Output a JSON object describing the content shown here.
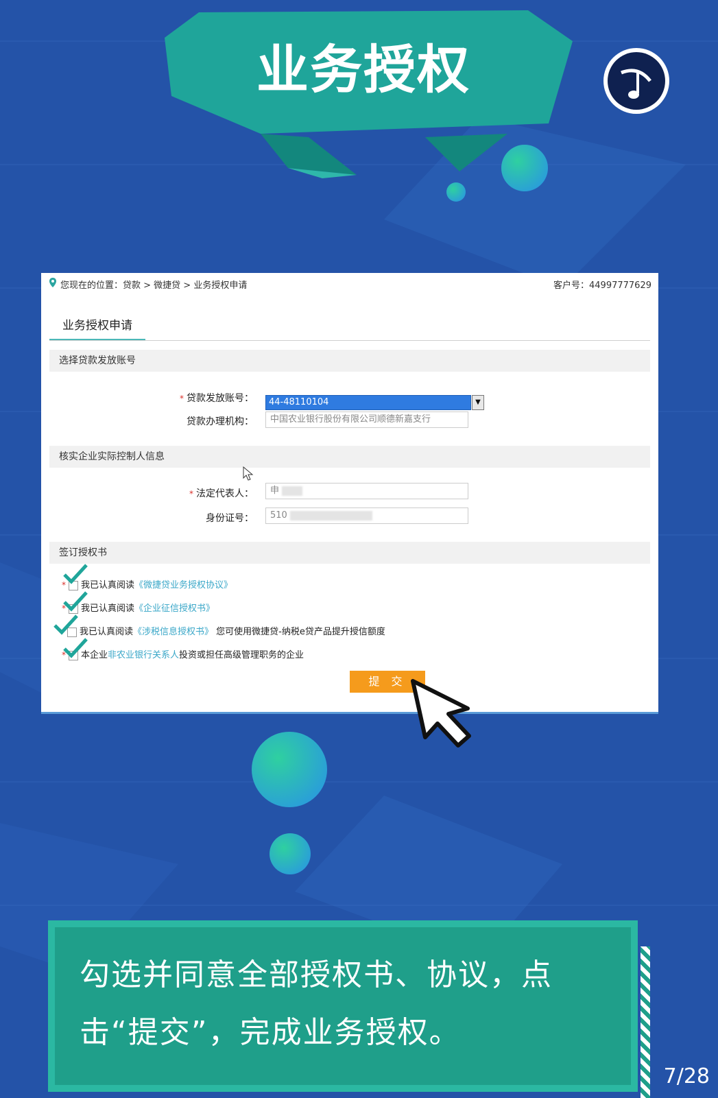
{
  "banner": {
    "title": "业务授权"
  },
  "logo": {
    "icon": "music-note-icon"
  },
  "screen": {
    "breadcrumb": "您现在的位置：贷款 > 微捷贷 > 业务授权申请",
    "customer_id": "客户号：44997777629",
    "tab": "业务授权申请",
    "section_account": "选择贷款发放账号",
    "label_account": "贷款发放账号：",
    "account_value": "44-48110104",
    "label_org": "贷款办理机构：",
    "org_placeholder": "中国农业银行股份有限公司顺德新嘉支行",
    "section_controller": "核实企业实际控制人信息",
    "label_legal_rep": "法定代表人：",
    "legal_rep_value": "申",
    "label_id": "身份证号：",
    "id_value": "510",
    "section_sign": "签订授权书",
    "agree1_prefix": "我已认真阅读",
    "agree1_link": "《微捷贷业务授权协议》",
    "agree2_prefix": "我已认真阅读",
    "agree2_link": "《企业征信授权书》",
    "agree3_prefix": "我已认真阅读",
    "agree3_link": "《涉税信息授权书》",
    "agree3_suffix": "您可使用微捷贷-纳税e贷产品提升授信额度",
    "agree4_prefix": "本企业",
    "agree4_link": "非农业银行关系人",
    "agree4_suffix": "投资或担任高级管理职务的企业",
    "submit": "提 交"
  },
  "caption": {
    "text": "勾选并同意全部授权书、协议，点击“提交”，完成业务授权。",
    "page": "7/28"
  },
  "colors": {
    "background": "#2453a8",
    "teal": "#1f9f8a",
    "submit": "#f59b1c",
    "link": "#3aa7c8"
  }
}
